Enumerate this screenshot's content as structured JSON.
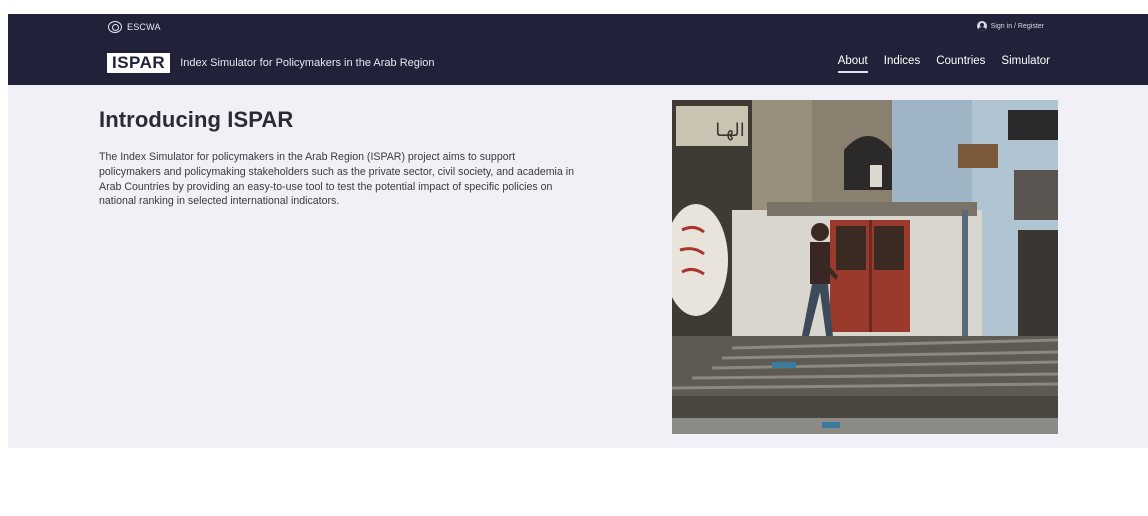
{
  "header": {
    "org_name": "ESCWA",
    "signin_label": "Sign in / Register",
    "logo_text": "ISPAR",
    "tagline": "Index Simulator for Policymakers in the Arab Region",
    "nav": [
      {
        "label": "About",
        "active": true
      },
      {
        "label": "Indices",
        "active": false
      },
      {
        "label": "Countries",
        "active": false
      },
      {
        "label": "Simulator",
        "active": false
      }
    ]
  },
  "hero": {
    "title": "Introducing ISPAR",
    "body": "The Index Simulator for policymakers in the Arab Region (ISPAR) project aims to support policymakers and policymaking stakeholders such as the private sector, civil society, and academia in Arab Countries by providing an easy-to-use tool to test the potential impact of specific policies on national ranking in selected international indicators.",
    "image_sign_text": "الهـا"
  },
  "colors": {
    "header_bg": "#21223a",
    "hero_bg": "#f1f0f7",
    "text_dark": "#2b2b35"
  }
}
